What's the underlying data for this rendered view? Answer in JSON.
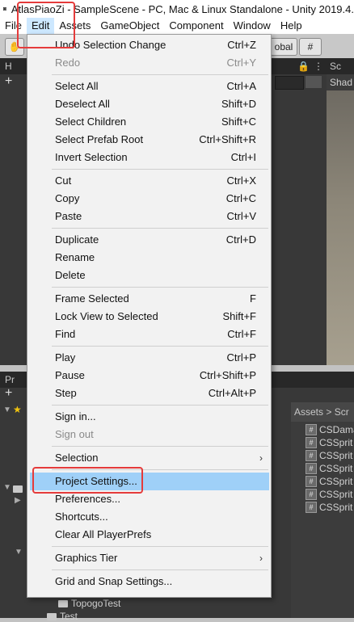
{
  "window": {
    "title": "AtlasPiaoZi - SampleScene - PC, Mac & Linux Standalone - Unity 2019.4."
  },
  "menubar": {
    "items": [
      "File",
      "Edit",
      "Assets",
      "GameObject",
      "Component",
      "Window",
      "Help"
    ]
  },
  "toolbar": {
    "global_label": "obal"
  },
  "panels": {
    "hierarchy_tab": "H",
    "scene_tab": "Sc",
    "scene_shading": "Shad",
    "project_tab": "Pr",
    "project_breadcrumb": "Assets > Scr",
    "project_files": [
      "CSDama",
      "CSSprit",
      "CSSprit",
      "CSSprit",
      "CSSprit",
      "CSSprit",
      "CSSprit"
    ],
    "tree_items": [
      "TopogoTest",
      "Test"
    ]
  },
  "edit_menu": {
    "items": [
      {
        "label": "Undo Selection Change",
        "shortcut": "Ctrl+Z"
      },
      {
        "label": "Redo",
        "shortcut": "Ctrl+Y",
        "disabled": true
      },
      {
        "label": "Select All",
        "shortcut": "Ctrl+A"
      },
      {
        "label": "Deselect All",
        "shortcut": "Shift+D"
      },
      {
        "label": "Select Children",
        "shortcut": "Shift+C"
      },
      {
        "label": "Select Prefab Root",
        "shortcut": "Ctrl+Shift+R"
      },
      {
        "label": "Invert Selection",
        "shortcut": "Ctrl+I"
      },
      {
        "label": "Cut",
        "shortcut": "Ctrl+X"
      },
      {
        "label": "Copy",
        "shortcut": "Ctrl+C"
      },
      {
        "label": "Paste",
        "shortcut": "Ctrl+V"
      },
      {
        "label": "Duplicate",
        "shortcut": "Ctrl+D"
      },
      {
        "label": "Rename",
        "shortcut": ""
      },
      {
        "label": "Delete",
        "shortcut": ""
      },
      {
        "label": "Frame Selected",
        "shortcut": "F"
      },
      {
        "label": "Lock View to Selected",
        "shortcut": "Shift+F"
      },
      {
        "label": "Find",
        "shortcut": "Ctrl+F"
      },
      {
        "label": "Play",
        "shortcut": "Ctrl+P"
      },
      {
        "label": "Pause",
        "shortcut": "Ctrl+Shift+P"
      },
      {
        "label": "Step",
        "shortcut": "Ctrl+Alt+P"
      },
      {
        "label": "Sign in...",
        "shortcut": ""
      },
      {
        "label": "Sign out",
        "shortcut": "",
        "disabled": true
      },
      {
        "label": "Selection",
        "submenu": true
      },
      {
        "label": "Project Settings...",
        "shortcut": "",
        "highlighted": true
      },
      {
        "label": "Preferences...",
        "shortcut": ""
      },
      {
        "label": "Shortcuts...",
        "shortcut": ""
      },
      {
        "label": "Clear All PlayerPrefs",
        "shortcut": ""
      },
      {
        "label": "Graphics Tier",
        "submenu": true
      },
      {
        "label": "Grid and Snap Settings...",
        "shortcut": ""
      }
    ]
  },
  "colors": {
    "highlight": "#9fd0f8",
    "annotation_red": "#e53b3b"
  }
}
